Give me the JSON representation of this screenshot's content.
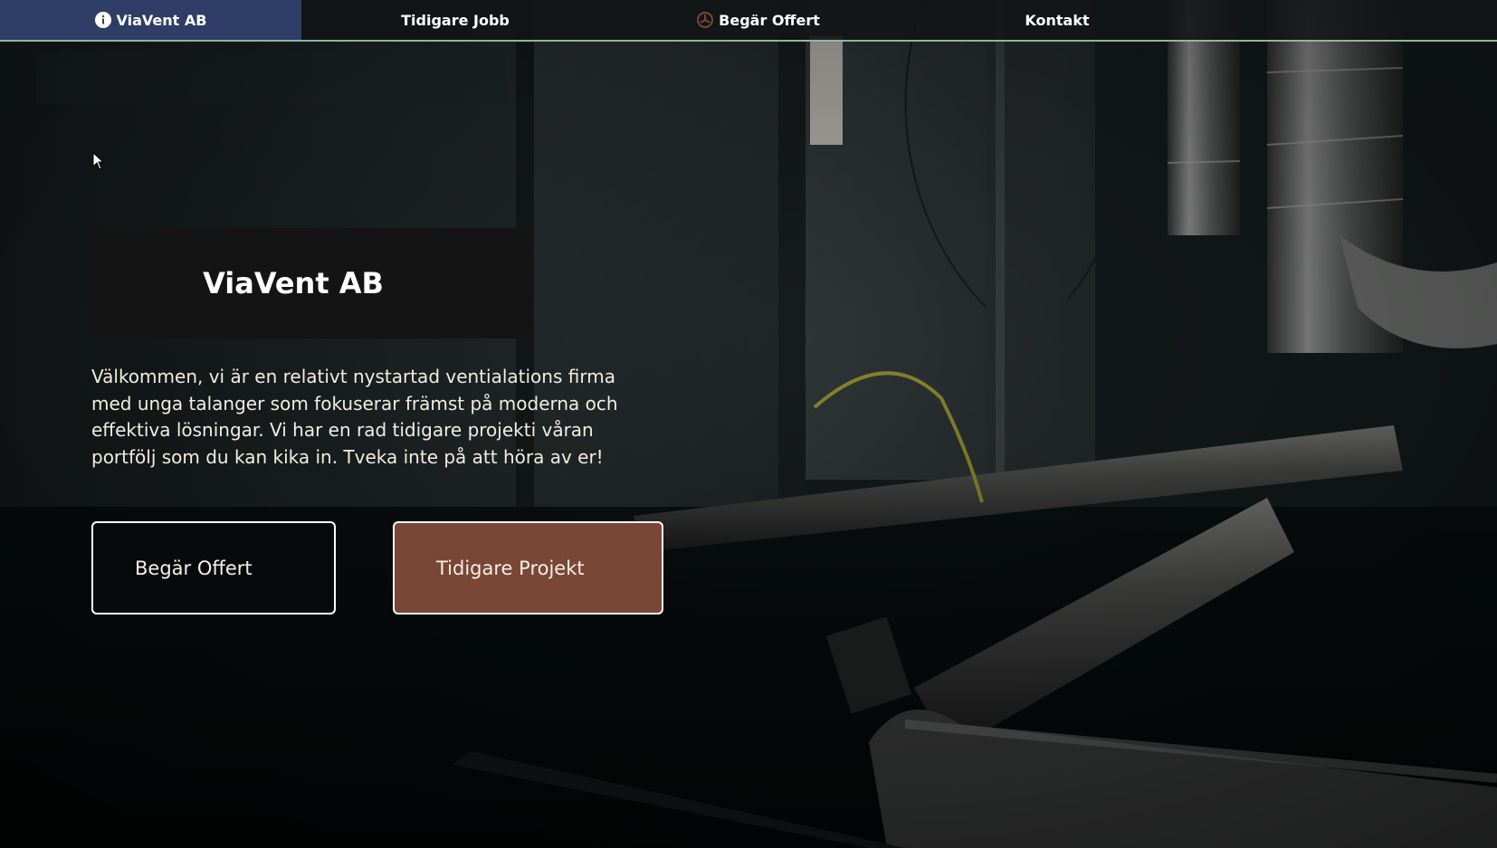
{
  "nav": {
    "items": [
      {
        "label": "ViaVent AB",
        "icon": "info-icon",
        "active": true
      },
      {
        "label": "Tidigare Jobb",
        "icon": null,
        "active": false
      },
      {
        "label": "Begär Offert",
        "icon": "fan-icon",
        "active": false
      },
      {
        "label": "Kontakt",
        "icon": null,
        "active": false
      }
    ]
  },
  "hero": {
    "title": "ViaVent AB",
    "text": "Välkommen, vi är en relativt nystartad ventialations firma med unga talanger som fokuserar främst på moderna och effektiva lösningar. Vi har en rad tidigare projekti våran portfölj som du kan kika in. Tveka inte på att höra av er!",
    "buttons": {
      "offert": "Begär Offert",
      "projekt": "Tidigare Projekt"
    }
  },
  "colors": {
    "nav_active": "#2f3e66",
    "nav_border": "#8fb69e",
    "title_box": "#141414",
    "btn_projekt": "#7a4636"
  }
}
